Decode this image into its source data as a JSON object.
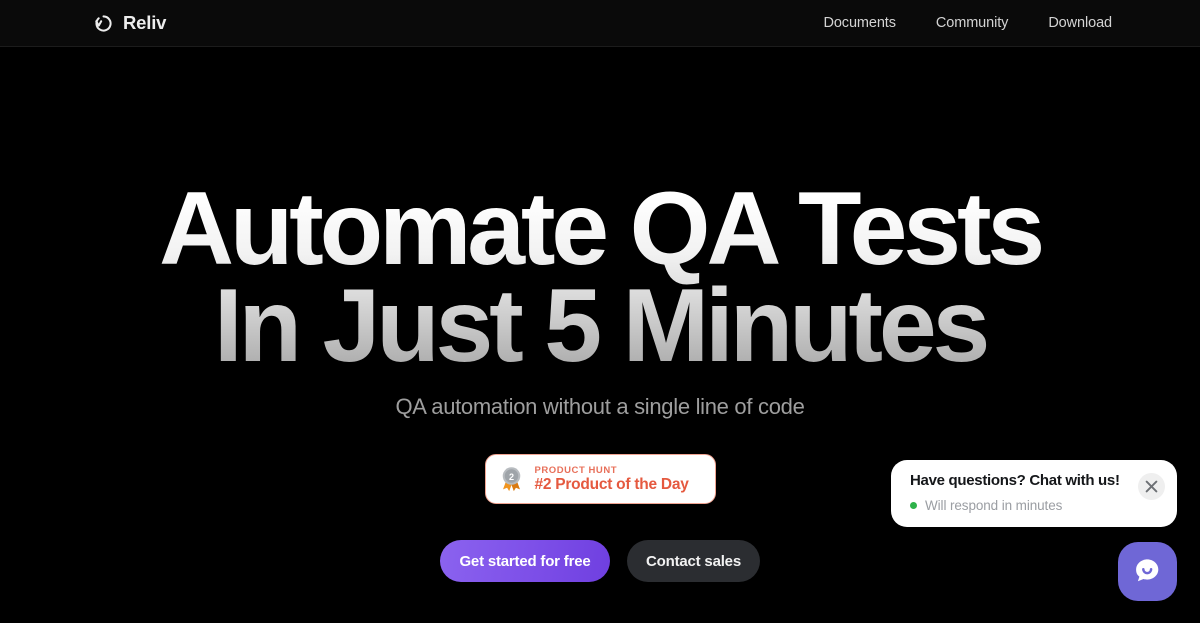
{
  "header": {
    "brand": {
      "name": "Reliv",
      "icon": "reliv-loop-logo-icon"
    },
    "nav": [
      {
        "label": "Documents"
      },
      {
        "label": "Community"
      },
      {
        "label": "Download"
      }
    ]
  },
  "hero": {
    "headline_line_1": "Automate QA Tests",
    "headline_line_2": "In Just 5 Minutes",
    "subtitle": "QA automation without a single line of code",
    "product_hunt": {
      "kicker": "PRODUCT HUNT",
      "title": "#2 Product of the Day",
      "medal_number": "2",
      "medal_icon": "silver-medal-icon",
      "border_color": "#f0a391",
      "text_color": "#e5593f"
    },
    "buttons": {
      "primary": {
        "label": "Get started for free",
        "color": "#7d4fe8"
      },
      "secondary": {
        "label": "Contact sales",
        "color": "#2b2d31"
      }
    }
  },
  "chat_widget": {
    "title": "Have questions? Chat with us!",
    "status_text": "Will respond in minutes",
    "status_color": "#2eb24a",
    "close_icon": "close-icon",
    "launcher_icon": "chat-bubble-smile-icon",
    "launcher_color": "#6f67d6"
  }
}
